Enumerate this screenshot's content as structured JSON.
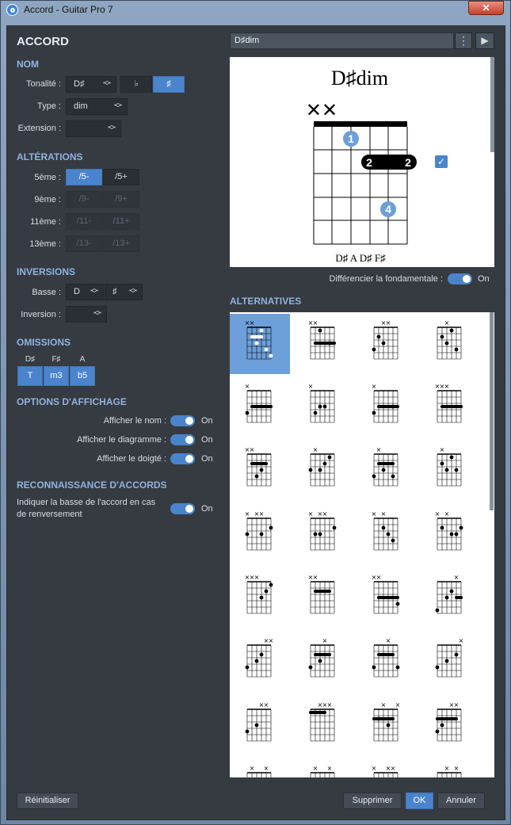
{
  "window": {
    "title": "Accord - Guitar Pro 7",
    "close_glyph": "✕"
  },
  "left": {
    "heading": "ACCORD",
    "nom": {
      "section": "NOM",
      "tonalite_label": "Tonalité :",
      "tonalite_value": "D♯",
      "flat": "♭",
      "sharp": "♯",
      "type_label": "Type :",
      "type_value": "dim",
      "extension_label": "Extension :",
      "extension_value": ""
    },
    "alterations": {
      "section": "ALTÉRATIONS",
      "rows": [
        {
          "label": "5ème :",
          "a": "/5-",
          "b": "/5+"
        },
        {
          "label": "9ème :",
          "a": "/9-",
          "b": "/9+"
        },
        {
          "label": "11ème :",
          "a": "/11-",
          "b": "/11+"
        },
        {
          "label": "13ème :",
          "a": "/13-",
          "b": "/13+"
        }
      ]
    },
    "inversions": {
      "section": "INVERSIONS",
      "basse_label": "Basse :",
      "basse_note": "D",
      "basse_acc": "♯",
      "inversion_label": "Inversion :",
      "inversion_value": ""
    },
    "omissions": {
      "section": "OMISSIONS",
      "notes": [
        "D♯",
        "F♯",
        "A"
      ],
      "buttons": [
        "T",
        "m3",
        "b5"
      ]
    },
    "affichage": {
      "section": "OPTIONS D'AFFICHAGE",
      "items": [
        {
          "label": "Afficher le nom :",
          "state": "On"
        },
        {
          "label": "Afficher le diagramme :",
          "state": "On"
        },
        {
          "label": "Afficher le doigté :",
          "state": "On"
        }
      ]
    },
    "reconnaissance": {
      "section": "RECONNAISSANCE D'ACCORDS",
      "line1": "Indiquer la basse de l'accord en cas",
      "line2": "de renversement",
      "state": "On"
    }
  },
  "right": {
    "chord_name_field": "D♯dim",
    "menu_glyph": "⋮",
    "play_glyph": "▶",
    "diagram": {
      "name": "D♯dim",
      "mutes": "✕✕",
      "finger1": "1",
      "finger2": "2",
      "finger2b": "2",
      "finger4": "4",
      "notes": "D♯  A  D♯  F♯"
    },
    "diff_label": "Différencier la fondamentale :",
    "diff_state": "On",
    "alternatives_section": "ALTERNATIVES"
  },
  "footer": {
    "reset": "Réinitialiser",
    "delete": "Supprimer",
    "ok": "OK",
    "cancel": "Annuler"
  },
  "colors": {
    "accent": "#4a84cc",
    "panel": "#363b42",
    "heading": "#8fb3de"
  }
}
